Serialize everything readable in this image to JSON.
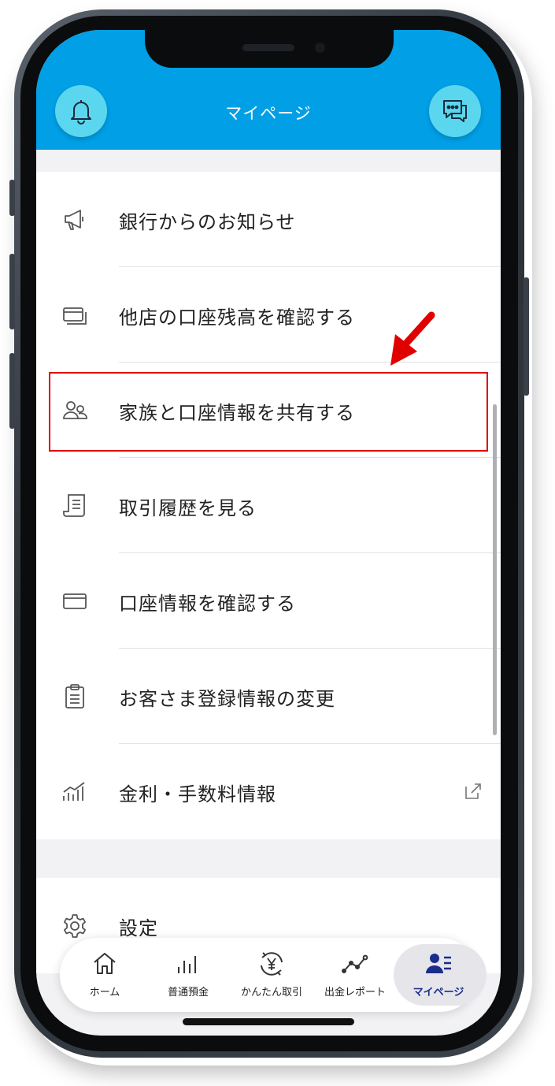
{
  "header": {
    "title": "マイページ"
  },
  "menu_group1": [
    {
      "label": "銀行からのお知らせ",
      "icon": "megaphone-icon"
    },
    {
      "label": "他店の口座残高を確認する",
      "icon": "cards-icon"
    },
    {
      "label": "家族と口座情報を共有する",
      "icon": "family-icon"
    },
    {
      "label": "取引履歴を見る",
      "icon": "receipt-icon"
    },
    {
      "label": "口座情報を確認する",
      "icon": "card-icon"
    },
    {
      "label": "お客さま登録情報の変更",
      "icon": "clipboard-icon"
    },
    {
      "label": "金利・手数料情報",
      "icon": "chart-bars-icon"
    }
  ],
  "menu_group2": [
    {
      "label": "設定",
      "icon": "gear-icon"
    }
  ],
  "tabbar": [
    {
      "label": "ホーム",
      "icon": "home-icon"
    },
    {
      "label": "普通預金",
      "icon": "bars-icon"
    },
    {
      "label": "かんたん取引",
      "icon": "yen-exchange-icon"
    },
    {
      "label": "出金レポート",
      "icon": "line-chart-icon"
    },
    {
      "label": "マイページ",
      "icon": "mypage-icon",
      "active": true
    }
  ],
  "colors": {
    "header": "#009fe6",
    "header_button": "#5ad7ee",
    "highlight": "#e10000",
    "active_tab": "#1a2d8a"
  }
}
